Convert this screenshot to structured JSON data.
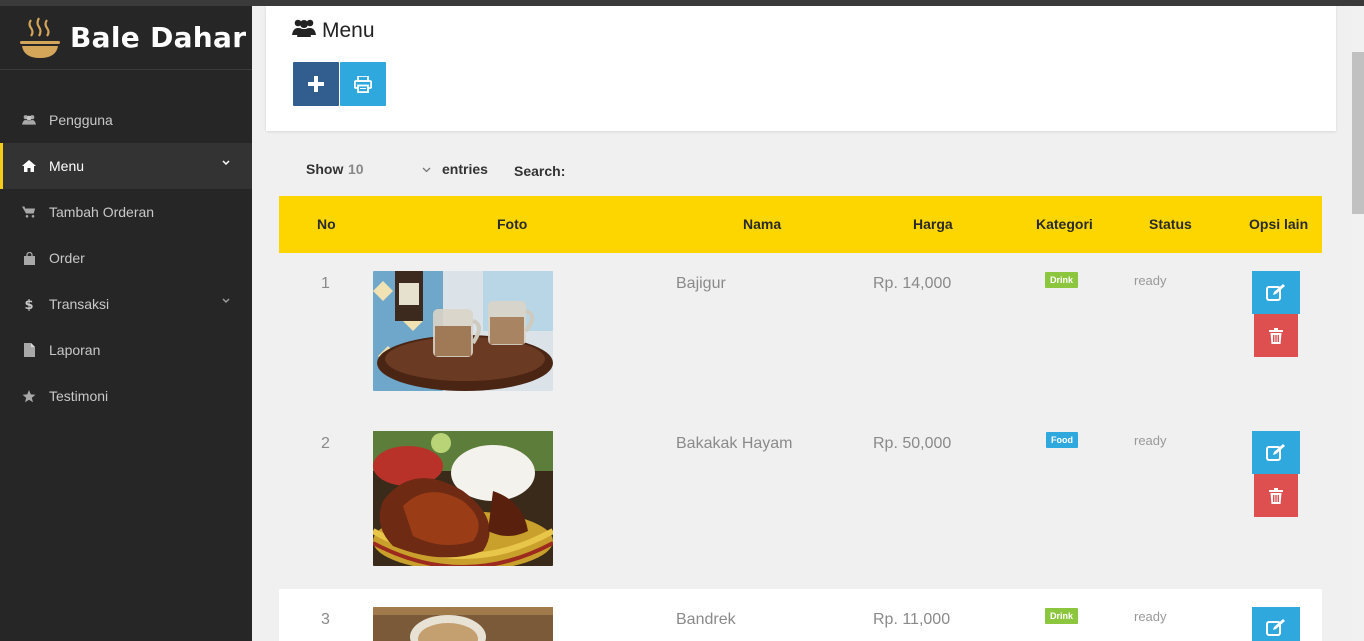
{
  "app": {
    "name": "Bale Dahar"
  },
  "sidebar": {
    "items": [
      {
        "label": "Pengguna",
        "icon": "users-icon"
      },
      {
        "label": "Menu",
        "icon": "home-icon",
        "active": true,
        "expandable": true
      },
      {
        "label": "Tambah Orderan",
        "icon": "cart-icon"
      },
      {
        "label": "Order",
        "icon": "shopping-bag-icon"
      },
      {
        "label": "Transaksi",
        "icon": "dollar-icon",
        "expandable": true
      },
      {
        "label": "Laporan",
        "icon": "file-icon"
      },
      {
        "label": "Testimoni",
        "icon": "star-icon"
      }
    ]
  },
  "page": {
    "title": "Menu",
    "title_icon": "users-icon"
  },
  "toolbar": {
    "add_icon": "plus-icon",
    "print_icon": "print-icon"
  },
  "table_controls": {
    "show_label": "Show",
    "length_value": "10",
    "entries_label": "entries",
    "search_label": "Search:"
  },
  "table": {
    "headers": [
      "No",
      "Foto",
      "Nama",
      "Harga",
      "Kategori",
      "Status",
      "Opsi lain"
    ],
    "rows": [
      {
        "no": "1",
        "nama": "Bajigur",
        "harga": "Rp. 14,000",
        "kategori": "Drink",
        "status": "ready"
      },
      {
        "no": "2",
        "nama": "Bakakak Hayam",
        "harga": "Rp. 50,000",
        "kategori": "Food",
        "status": "ready"
      },
      {
        "no": "3",
        "nama": "Bandrek",
        "harga": "Rp. 11,000",
        "kategori": "Drink",
        "status": "ready"
      }
    ]
  },
  "colors": {
    "sidebar_bg": "#262626",
    "accent_yellow": "#fdd600",
    "add_button": "#315d8f",
    "print_button": "#2fa8de",
    "edit_button": "#2fa8de",
    "delete_button": "#de5050",
    "badge_drink": "#8cc63f",
    "badge_food": "#2fa8de"
  }
}
